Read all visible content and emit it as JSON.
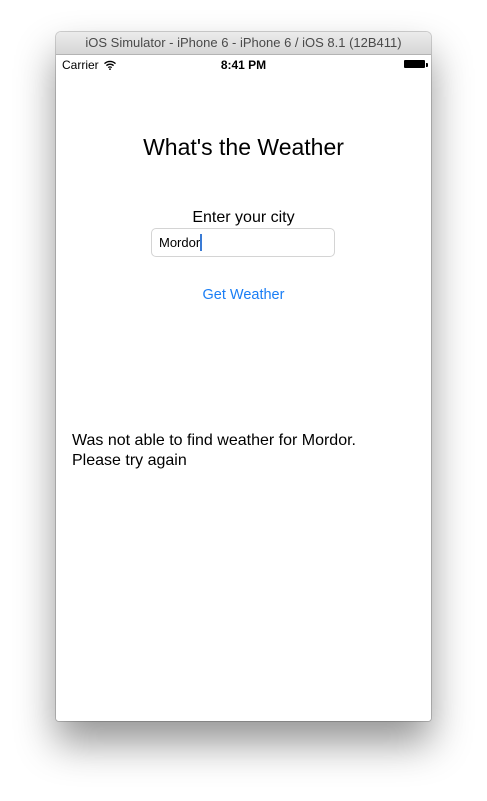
{
  "window": {
    "title": "iOS Simulator - iPhone 6 - iPhone 6 / iOS 8.1 (12B411)"
  },
  "status_bar": {
    "carrier": "Carrier",
    "wifi_icon": "wifi-icon",
    "time": "8:41 PM",
    "battery_icon": "battery-icon"
  },
  "app": {
    "title": "What's the Weather",
    "city_label": "Enter your city",
    "city_input_value": "Mordor",
    "get_weather_label": "Get Weather",
    "result_text": "Was not able to find weather for Mordor.\nPlease try again"
  },
  "colors": {
    "accent": "#1a7ef5",
    "caret": "#3a7bd5"
  }
}
